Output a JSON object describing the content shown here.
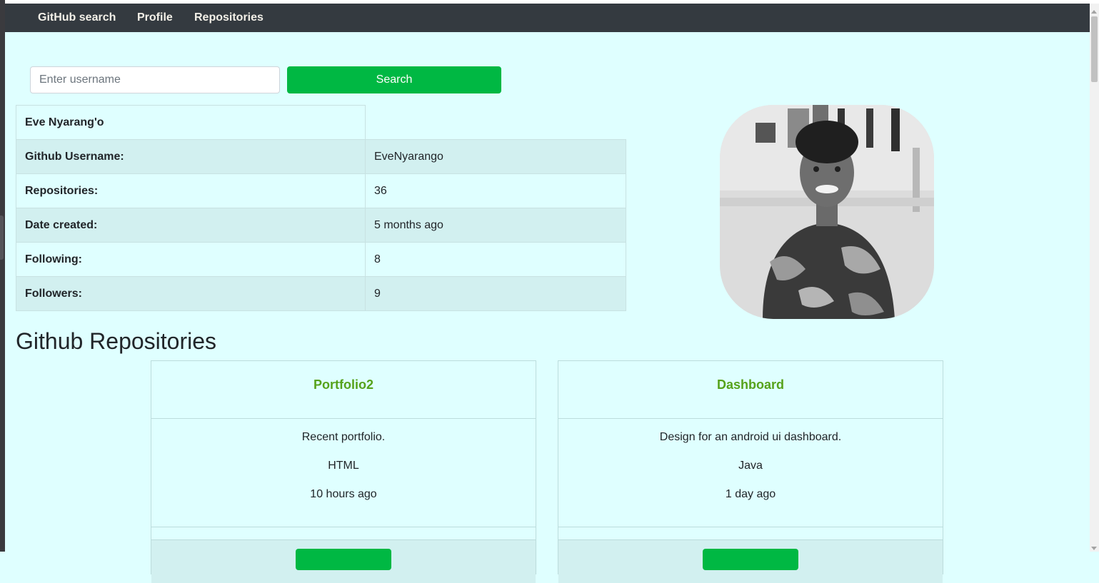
{
  "navbar": {
    "brand": "GitHub search",
    "links": [
      "Profile",
      "Repositories"
    ]
  },
  "search": {
    "placeholder": "Enter username",
    "value": "",
    "button_label": "Search"
  },
  "profile": {
    "name": "Eve Nyarang'o",
    "rows": [
      {
        "label": "Github Username:",
        "value": "EveNyarango"
      },
      {
        "label": "Repositories:",
        "value": "36"
      },
      {
        "label": "Date created:",
        "value": "5 months ago"
      },
      {
        "label": "Following:",
        "value": "8"
      },
      {
        "label": "Followers:",
        "value": "9"
      }
    ]
  },
  "repositories": {
    "title": "Github Repositories",
    "items": [
      {
        "name": "Portfolio2",
        "description": "Recent portfolio.",
        "language": "HTML",
        "updated": "10 hours ago"
      },
      {
        "name": "Dashboard",
        "description": "Design for an android ui dashboard.",
        "language": "Java",
        "updated": "1 day ago"
      }
    ]
  },
  "colors": {
    "page_bg": "#dfffff",
    "navbar_bg": "#343a40",
    "accent_green": "#00b843",
    "repo_name": "#56a21a"
  }
}
